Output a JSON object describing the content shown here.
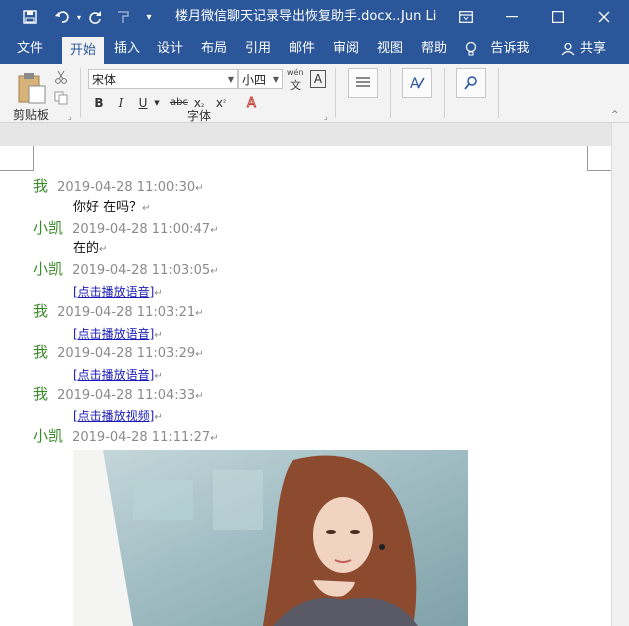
{
  "window": {
    "title": "楼月微信聊天记录导出恢复助手.docx...",
    "user": "Jun Li"
  },
  "tabs": [
    "文件",
    "开始",
    "插入",
    "设计",
    "布局",
    "引用",
    "邮件",
    "审阅",
    "视图",
    "帮助",
    "告诉我",
    "共享"
  ],
  "ribbon": {
    "clipboard_label": "剪贴板",
    "font_name": "宋体",
    "font_size": "小四",
    "font_group_label": "字体",
    "wen_label": "wén",
    "wen_char": "文",
    "a_box": "A",
    "bold": "B",
    "italic": "I",
    "underline": "U",
    "strike": "abc",
    "subscript": "x",
    "subscript_mark": "₂",
    "superscript": "x",
    "superscript_mark": "²"
  },
  "paragraph_mark": "↵",
  "messages": [
    {
      "sender": "我",
      "time": "2019-04-28 11:00:30",
      "content": "你好 在吗？",
      "type": "text"
    },
    {
      "sender": "小凯",
      "time": "2019-04-28 11:00:47",
      "content": "在的",
      "type": "text"
    },
    {
      "sender": "小凯",
      "time": "2019-04-28 11:03:05",
      "content": "[点击播放语音]",
      "type": "link"
    },
    {
      "sender": "我",
      "time": "2019-04-28 11:03:21",
      "content": "[点击播放语音]",
      "type": "link"
    },
    {
      "sender": "我",
      "time": "2019-04-28 11:03:29",
      "content": "[点击播放语音]",
      "type": "link"
    },
    {
      "sender": "我",
      "time": "2019-04-28 11:04:33",
      "content": "[点击播放视频]",
      "type": "link"
    },
    {
      "sender": "小凯",
      "time": "2019-04-28 11:11:27",
      "content": "",
      "type": "image"
    }
  ]
}
